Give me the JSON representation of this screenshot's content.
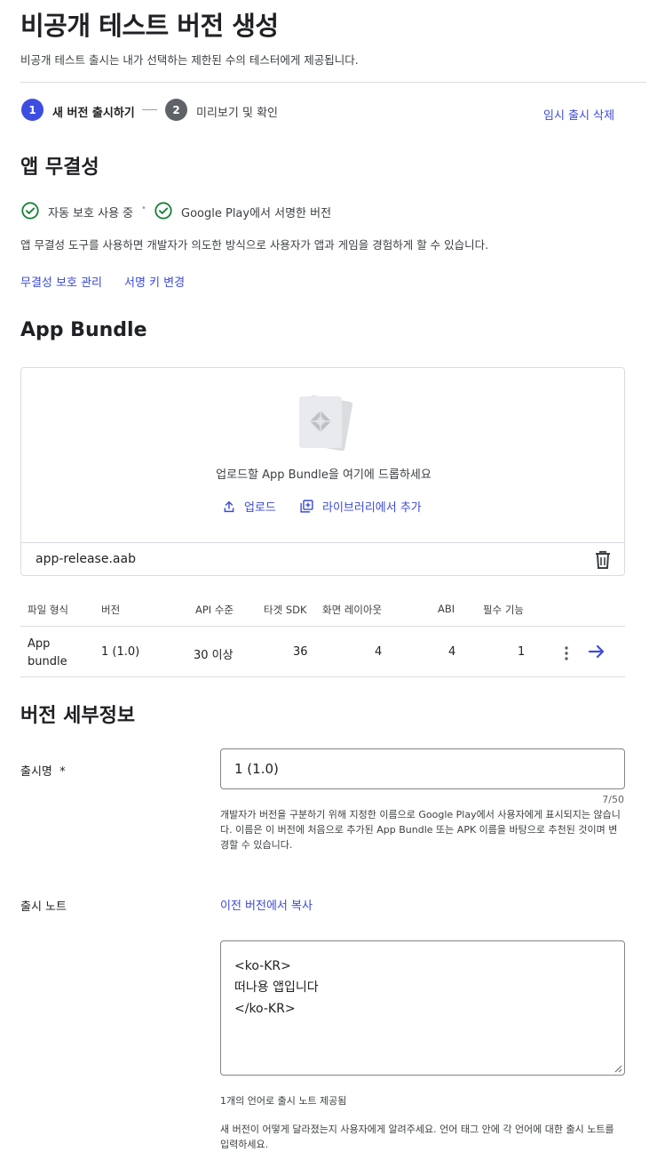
{
  "header": {
    "title": "비공개 테스트 버전 생성",
    "subtitle": "비공개 테스트 출시는 내가 선택하는 제한된 수의 테스터에게 제공됩니다."
  },
  "stepper": {
    "steps": [
      {
        "number": "1",
        "label": "새 버전 출시하기"
      },
      {
        "number": "2",
        "label": "미리보기 및 확인"
      }
    ],
    "discard_label": "임시 출시 삭제"
  },
  "integrity": {
    "title": "앱 무결성",
    "status_items": [
      "자동 보호 사용 중",
      "Google Play에서 서명한 버전"
    ],
    "separator": "•",
    "description": "앱 무결성 도구를 사용하면 개발자가 의도한 방식으로 사용자가 앱과 게임을 경험하게 할 수 있습니다.",
    "links": [
      "무결성 보호 관리",
      "서명 키 변경"
    ]
  },
  "bundle": {
    "title": "App Bundle",
    "drop_text": "업로드할 App Bundle을 여기에 드롭하세요",
    "upload_label": "업로드",
    "library_label": "라이브러리에서 추가",
    "file_name": "app-release.aab"
  },
  "table": {
    "headers": [
      "파일 형식",
      "버전",
      "API 수준",
      "타겟 SDK",
      "화면 레이아웃",
      "ABI",
      "필수 기능"
    ],
    "row": {
      "type_line1": "App",
      "type_line2": "bundle",
      "version": "1 (1.0)",
      "api": "30 이상",
      "target_sdk": "36",
      "layouts": "4",
      "abi": "4",
      "features": "1"
    }
  },
  "details": {
    "title": "버전 세부정보",
    "release_name_label": "출시명",
    "required_mark": "*",
    "release_name_value": "1 (1.0)",
    "counter": "7/50",
    "release_name_help": "개발자가 버전을 구분하기 위해 지정한 이름으로 Google Play에서 사용자에게 표시되지는 않습니다. 이름은 이 버전에 처음으로 추가된 App Bundle 또는 APK 이름을 바탕으로 추천된 것이며 변경할 수 있습니다.",
    "notes_label": "출시 노트",
    "copy_link": "이전 버전에서 복사",
    "notes_lines": [
      "<ko-KR>",
      "떠나용 앱입니다",
      "</ko-KR>"
    ],
    "notes_count_text": "1개의 언어로 출시 노트 제공됨",
    "notes_help": "새 버전이 어떻게 달라졌는지 사용자에게 알려주세요. 언어 태그 안에 각 언어에 대한 출시 노트를 입력하세요."
  },
  "colors": {
    "accent": "#3d4de0",
    "link": "#3b4bd6",
    "success": "#188038",
    "step_inactive": "#5f6368"
  },
  "icons": [
    "check-circle-icon",
    "upload-icon",
    "library-add-icon",
    "trash-icon",
    "more-vert-icon",
    "arrow-right-icon",
    "bundle-illustration"
  ]
}
